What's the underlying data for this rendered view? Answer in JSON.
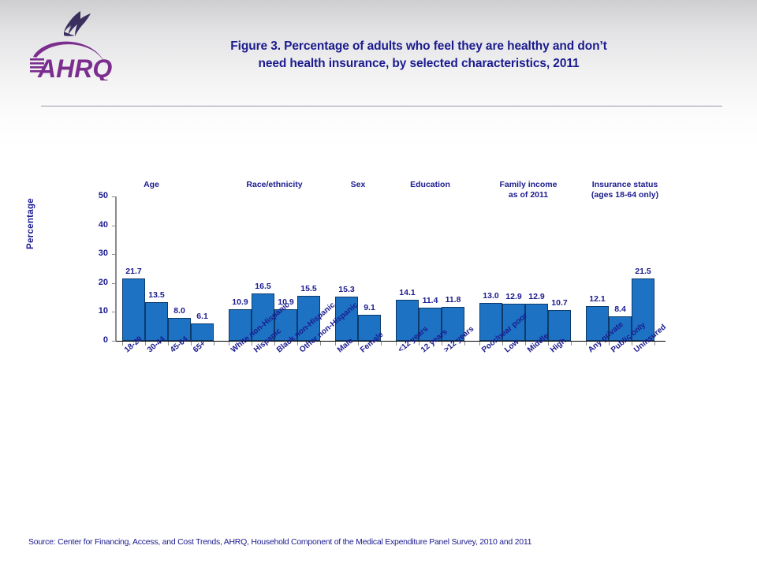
{
  "header": {
    "title": "Figure 3. Percentage of adults who feel they are healthy and don’t need health insurance, by selected characteristics, 2011",
    "title_line1": "Figure 3. Percentage of adults who feel they are healthy and don’t",
    "title_line2": "need health insurance, by selected characteristics, 2011",
    "logo_alt": "AHRQ",
    "logo_agency": "HHS",
    "title_color": "#1B1B8F",
    "logo_color": "#7B2E8E"
  },
  "footer": {
    "source": "Source: Center for Financing, Access, and Cost Trends, AHRQ, Household Component of the Medical Expenditure Panel Survey,  2010 and 2011"
  },
  "chart_data": {
    "type": "bar",
    "title": "Figure 3. Percentage of adults who feel they are healthy and don’t need health insurance, by selected characteristics, 2011",
    "xlabel": "",
    "ylabel": "Percentage",
    "ylim": [
      0,
      50
    ],
    "yticks": [
      0,
      10,
      20,
      30,
      40,
      50
    ],
    "ytick_labels": [
      "0",
      "10",
      "20",
      "30",
      "40",
      "50"
    ],
    "grid": false,
    "legend": null,
    "bar_color": "#1d72c4",
    "bar_edge_color": "#0d3a6b",
    "categories": [
      "18-29",
      "30-44",
      "45-64",
      "65+",
      "White non-Hispanic",
      "Hispanic",
      "Black non-Hispanic",
      "Other non-Hispanic",
      "Male",
      "Female",
      "<12 years",
      "12 years",
      ">12 years",
      "Poor/near poor",
      "Low",
      "Middle",
      "High",
      "Any private",
      "Public only",
      "Uninsured"
    ],
    "values": [
      21.7,
      13.5,
      8.0,
      6.1,
      10.9,
      16.5,
      10.9,
      15.5,
      15.3,
      9.1,
      14.1,
      11.4,
      11.8,
      13.0,
      12.9,
      12.9,
      10.7,
      12.1,
      8.4,
      21.5
    ],
    "data_labels": [
      "21.7",
      "13.5",
      "8.0",
      "6.1",
      "10.9",
      "16.5",
      "10.9",
      "15.5",
      "15.3",
      "9.1",
      "14.1",
      "11.4",
      "11.8",
      "13.0",
      "12.9",
      "12.9",
      "10.7",
      "12.1",
      "8.4",
      "21.5"
    ],
    "groups": [
      {
        "label": "Age",
        "label_line2": "",
        "categories": [
          "18-29",
          "30-44",
          "45-64",
          "65+"
        ],
        "values": [
          21.7,
          13.5,
          8.0,
          6.1
        ]
      },
      {
        "label": "Race/ethnicity",
        "label_line2": "",
        "categories": [
          "White non-Hispanic",
          "Hispanic",
          "Black non-Hispanic",
          "Other non-Hispanic"
        ],
        "values": [
          10.9,
          16.5,
          10.9,
          15.5
        ]
      },
      {
        "label": "Sex",
        "label_line2": "",
        "categories": [
          "Male",
          "Female"
        ],
        "values": [
          15.3,
          9.1
        ]
      },
      {
        "label": "Education",
        "label_line2": "",
        "categories": [
          "<12 years",
          "12 years",
          ">12 years"
        ],
        "values": [
          14.1,
          11.4,
          11.8
        ]
      },
      {
        "label": "Family income",
        "label_line2": "as of 2011",
        "categories": [
          "Poor/near poor",
          "Low",
          "Middle",
          "High"
        ],
        "values": [
          13.0,
          12.9,
          12.9,
          10.7
        ]
      },
      {
        "label": "Insurance status",
        "label_line2": "(ages 18-64  only)",
        "categories": [
          "Any private",
          "Public only",
          "Uninsured"
        ],
        "values": [
          12.1,
          8.4,
          21.5
        ]
      }
    ]
  }
}
